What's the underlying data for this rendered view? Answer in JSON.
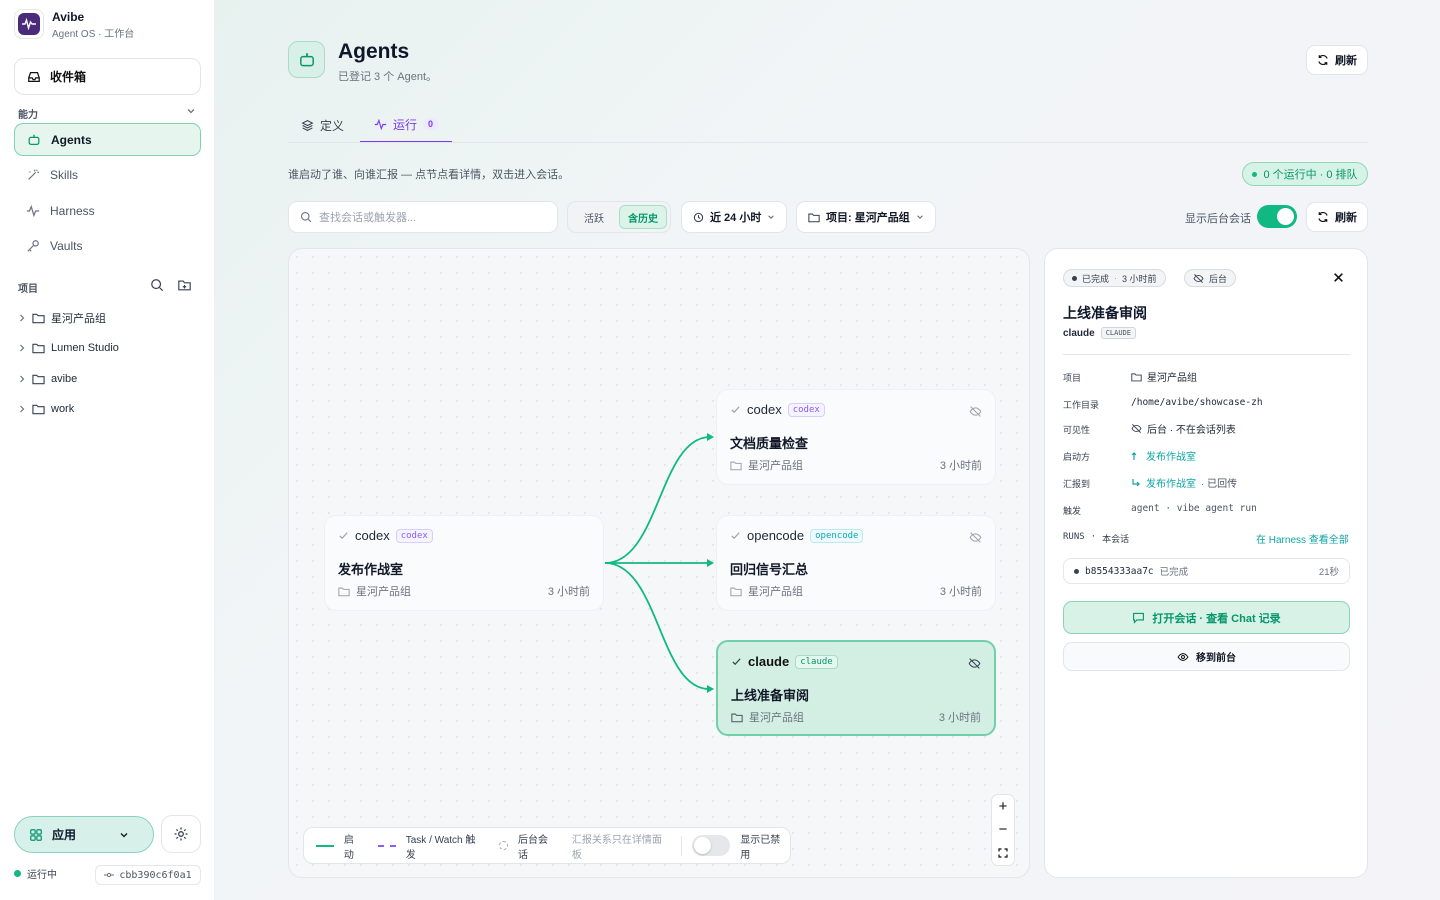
{
  "app": {
    "name": "Avibe",
    "subtitle": "Agent OS · 工作台"
  },
  "sidebar": {
    "inbox_label": "收件箱",
    "capabilities_label": "能力",
    "nav": [
      {
        "label": "Agents",
        "icon": "bot-icon",
        "active": true
      },
      {
        "label": "Skills",
        "icon": "wand-icon"
      },
      {
        "label": "Harness",
        "icon": "activity-icon"
      },
      {
        "label": "Vaults",
        "icon": "key-icon"
      }
    ],
    "projects_label": "项目",
    "projects": [
      "星河产品组",
      "Lumen Studio",
      "avibe",
      "work"
    ],
    "apps_label": "应用",
    "status_text": "运行中",
    "commit": "cbb390c6f0a1"
  },
  "header": {
    "title": "Agents",
    "subtitle": "已登记 3 个 Agent。",
    "refresh_label": "刷新"
  },
  "tabs": [
    {
      "label": "定义",
      "icon": "layers-icon"
    },
    {
      "label": "运行",
      "icon": "activity-icon",
      "badge": "0",
      "active": true
    }
  ],
  "toolbar": {
    "hint": "谁启动了谁、向谁汇报 — 点节点看详情，双击进入会话。",
    "running_pill": "0 个运行中 · 0 排队",
    "search_placeholder": "查找会话或触发器...",
    "seg_active": "活跃",
    "seg_history": "含历史",
    "time_filter": "近 24 小时",
    "project_filter": "项目: 星河产品组",
    "show_background_label": "显示后台会话",
    "refresh_label": "刷新"
  },
  "graph": {
    "nodes": [
      {
        "agent": "codex",
        "chip": "codex",
        "task": "发布作战室",
        "project": "星河产品组",
        "time": "3 小时前"
      },
      {
        "agent": "codex",
        "chip": "codex",
        "task": "文档质量检查",
        "project": "星河产品组",
        "time": "3 小时前"
      },
      {
        "agent": "opencode",
        "chip": "opencode",
        "task": "回归信号汇总",
        "project": "星河产品组",
        "time": "3 小时前"
      },
      {
        "agent": "claude",
        "chip": "claude",
        "task": "上线准备审阅",
        "project": "星河产品组",
        "time": "3 小时前"
      }
    ],
    "legend": {
      "start": "启动",
      "task_watch": "Task / Watch 触发",
      "background": "后台会话",
      "report_note": "汇报关系只在详情面板",
      "show_disabled": "显示已禁用"
    },
    "colors": {
      "start_edge": "#10b981",
      "task_edge": "#8b5cf6"
    }
  },
  "detail": {
    "status": "已完成",
    "status_time": "3 小时前",
    "background_tag": "后台",
    "title": "上线准备审阅",
    "agent": "claude",
    "agent_chip": "CLAUDE",
    "rows": [
      {
        "key": "项目",
        "value": "星河产品组"
      },
      {
        "key": "工作目录",
        "value": "/home/avibe/showcase-zh"
      },
      {
        "key": "可见性",
        "value": "后台 · 不在会话列表"
      },
      {
        "key": "启动方",
        "value": "发布作战室"
      },
      {
        "key": "汇报到",
        "value": "发布作战室",
        "suffix": "· 已回传"
      },
      {
        "key": "触发",
        "value": "agent · vibe agent run"
      }
    ],
    "runs_label": "RUNS",
    "runs_scope": "本会话",
    "runs_link": "在 Harness 查看全部",
    "run": {
      "id": "b8554333aa7c",
      "status": "已完成",
      "duration": "21秒"
    },
    "open_chat": "打开会话 · 查看 Chat 记录",
    "move_foreground": "移到前台"
  }
}
